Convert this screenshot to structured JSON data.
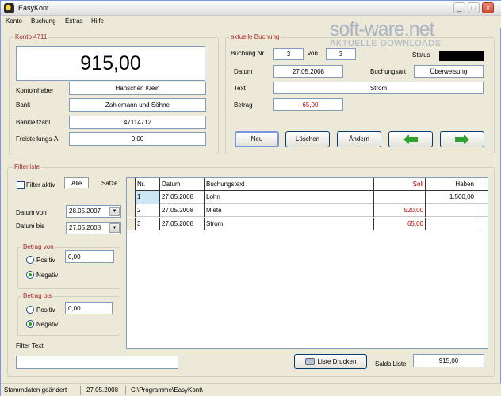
{
  "window": {
    "title": "EasyKont"
  },
  "menu": [
    "Konto",
    "Buchung",
    "Extras",
    "Hilfe"
  ],
  "watermark": {
    "main": "soft-ware.net",
    "sub": "AKTUELLE DOWNLOADS"
  },
  "konto": {
    "title": "Konto 4711",
    "balance": "915,00",
    "fields": [
      {
        "label": "Kontoinhaber",
        "value": "Hänschen Klein"
      },
      {
        "label": "Bank",
        "value": "Zahlemann und Söhne"
      },
      {
        "label": "Bankleitzahl",
        "value": "47114712"
      },
      {
        "label": "Freistellungs-A",
        "value": "0,00"
      }
    ]
  },
  "buchung": {
    "title": "aktuelle Buchung",
    "nr_label": "Buchung Nr.",
    "nr_value": "3",
    "von_label": "von",
    "von_value": "3",
    "status_label": "Status",
    "datum_label": "Datum",
    "datum_value": "27.05.2008",
    "art_label": "Buchungsart",
    "art_value": "Überweisung",
    "text_label": "Text",
    "text_value": "Strom",
    "betrag_label": "Betrag",
    "betrag_value": "- 65,00",
    "buttons": {
      "neu": "Neu",
      "loeschen": "Löschen",
      "aendern": "Ändern"
    },
    "arrow_color": "#2ea12e"
  },
  "filter": {
    "title": "Filterliste",
    "aktiv_label": "Filter aktiv",
    "tabs": [
      "Alle",
      "Sätze"
    ],
    "datum_von_label": "Datum von",
    "datum_von_value": "28.05.2007",
    "datum_bis_label": "Datum bis",
    "datum_bis_value": "27.05.2008",
    "betrag_von": {
      "title": "Betrag von",
      "positiv": "Positiv",
      "negativ": "Negativ",
      "value": "0,00"
    },
    "betrag_bis": {
      "title": "Betrag bis",
      "positiv": "Positiv",
      "negativ": "Negativ",
      "value": "0,00"
    },
    "text_label": "Filter Text",
    "text_value": ""
  },
  "table": {
    "columns": [
      "Nr.",
      "Datum",
      "Buchungstext",
      "Soll",
      "Haben"
    ],
    "rows": [
      {
        "nr": "1",
        "datum": "27.05.2008",
        "text": "Lohn",
        "soll": "",
        "haben": "1.500,00"
      },
      {
        "nr": "2",
        "datum": "27.05.2008",
        "text": "Miete",
        "soll": "520,00",
        "haben": ""
      },
      {
        "nr": "3",
        "datum": "27.05.2008",
        "text": "Strom",
        "soll": "65,00",
        "haben": ""
      }
    ]
  },
  "footer": {
    "print_button": "Liste Drucken",
    "saldo_label": "Saldo Liste",
    "saldo_value": "915,00"
  },
  "statusbar": [
    "Stammdaten geändert",
    "27.05.2008",
    "C:\\Programme\\EasyKont\\"
  ],
  "colors": {
    "accent_red": "#a52a2a",
    "soll_red": "#c00000"
  }
}
